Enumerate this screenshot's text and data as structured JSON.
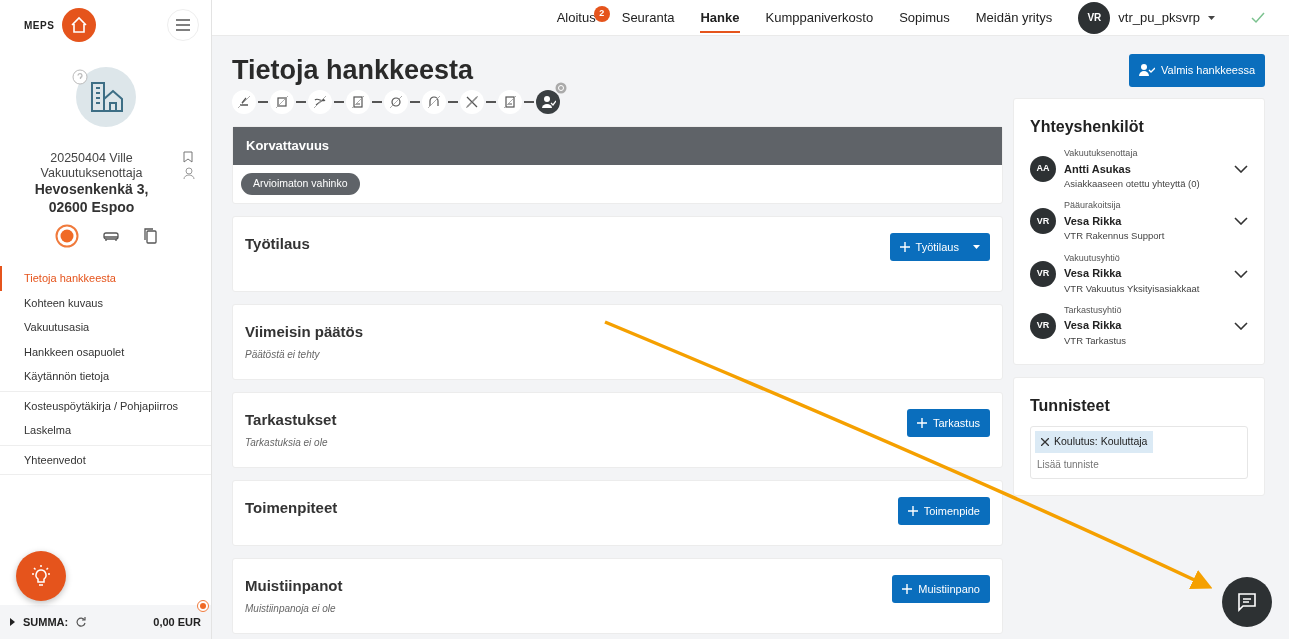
{
  "brand": {
    "name": "MEPS"
  },
  "project": {
    "line_1": "20250404 Ville",
    "line_2": "Vakuutuksenottaja",
    "address_1": "Hevosenkenkä 3,",
    "address_2": "02600 Espoo"
  },
  "sidebar": {
    "groups": [
      [
        {
          "label": "Tietoja hankkeesta",
          "selected": true
        },
        {
          "label": "Kohteen kuvaus",
          "selected": false
        },
        {
          "label": "Vakuutusasia",
          "selected": false
        },
        {
          "label": "Hankkeen osapuolet",
          "selected": false
        },
        {
          "label": "Käytännön tietoja",
          "selected": false
        }
      ],
      [
        {
          "label": "Kosteuspöytäkirja / Pohjapiirros",
          "selected": false
        },
        {
          "label": "Laskelma",
          "selected": false
        }
      ],
      [
        {
          "label": "Yhteenvedot",
          "selected": false
        }
      ]
    ]
  },
  "sum_bar": {
    "label": "SUMMA:",
    "amount": "0,00 EUR"
  },
  "top_nav": {
    "items": [
      {
        "label": "Aloitus",
        "selected": false,
        "badge": "2"
      },
      {
        "label": "Seuranta",
        "selected": false
      },
      {
        "label": "Hanke",
        "selected": true
      },
      {
        "label": "Kumppaniverkosto",
        "selected": false
      },
      {
        "label": "Sopimus",
        "selected": false
      },
      {
        "label": "Meidän yritys",
        "selected": false
      }
    ],
    "user": {
      "initials": "VR",
      "username": "vtr_pu_pksvrp"
    }
  },
  "page": {
    "title": "Tietoja hankkeesta",
    "header_button": "Valmis hankkeessa"
  },
  "steps": [
    {
      "selected": false
    },
    {
      "selected": false
    },
    {
      "selected": false
    },
    {
      "selected": false
    },
    {
      "selected": false
    },
    {
      "selected": false
    },
    {
      "selected": false
    },
    {
      "selected": false
    },
    {
      "selected": true
    }
  ],
  "sections": [
    {
      "kind": "status",
      "title": "Korvattavuus",
      "pill": "Arvioimaton vahinko"
    },
    {
      "kind": "action",
      "title": "Työtilaus",
      "button": "Työtilaus",
      "dropdown": true
    },
    {
      "kind": "plain",
      "title": "Viimeisin päätös",
      "subtitle": "Päätöstä ei tehty"
    },
    {
      "kind": "action",
      "title": "Tarkastukset",
      "subtitle": "Tarkastuksia ei ole",
      "button": "Tarkastus",
      "dropdown": false
    },
    {
      "kind": "action",
      "title": "Toimenpiteet",
      "button": "Toimenpide",
      "dropdown": false
    },
    {
      "kind": "action",
      "title": "Muistiinpanot",
      "subtitle": "Muistiinpanoja ei ole",
      "button": "Muistiinpano",
      "dropdown": false
    }
  ],
  "contacts": {
    "title": "Yhteyshenkilöt",
    "items": [
      {
        "initials": "AA",
        "role": "Vakuutuksenottaja",
        "name": "Antti Asukas",
        "detail": "Asiakkaaseen otettu yhteyttä (0)"
      },
      {
        "initials": "VR",
        "role": "Pääurakoitsija",
        "name": "Vesa Rikka",
        "detail": "VTR Rakennus Support"
      },
      {
        "initials": "VR",
        "role": "Vakuutusyhtiö",
        "name": "Vesa Rikka",
        "detail": "VTR Vakuutus Yksityisasiakkaat"
      },
      {
        "initials": "VR",
        "role": "Tarkastusyhtiö",
        "name": "Vesa Rikka",
        "detail": "VTR Tarkastus"
      }
    ]
  },
  "tags": {
    "title": "Tunnisteet",
    "items": [
      "Koulutus: Kouluttaja"
    ],
    "placeholder": "Lisää tunniste"
  }
}
